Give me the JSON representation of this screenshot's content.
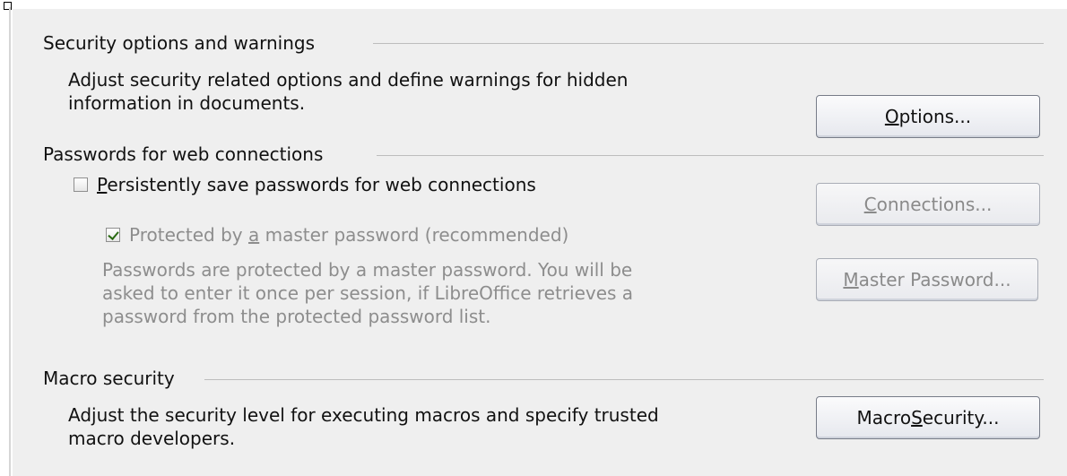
{
  "security_options": {
    "title": "Security options and warnings",
    "description_line1": "Adjust security related options and define warnings for hidden",
    "description_line2": "information in documents.",
    "options_button": {
      "mnemonic": "O",
      "rest": "ptions..."
    }
  },
  "passwords": {
    "title": "Passwords for web connections",
    "persist_checkbox": {
      "checked": false,
      "mnemonic": "P",
      "rest": "ersistently save passwords for web connections"
    },
    "connections_button": {
      "mnemonic": "C",
      "rest": "onnections...",
      "enabled": false
    },
    "master_checkbox": {
      "checked": true,
      "enabled": false,
      "prefix": "Protected by ",
      "mnemonic": "a",
      "suffix": " master password (recommended)"
    },
    "master_description_line1": "Passwords are protected by a master password. You will be",
    "master_description_line2": "asked to enter it once per session, if LibreOffice retrieves a",
    "master_description_line3": "password from the protected password list.",
    "master_password_button": {
      "mnemonic": "M",
      "rest": "aster Password...",
      "enabled": false
    }
  },
  "macro_security": {
    "title": "Macro security",
    "description_line1": "Adjust the security level for executing macros and specify trusted",
    "description_line2": "macro developers.",
    "macro_button": {
      "prefix": "Macro ",
      "mnemonic": "S",
      "rest": "ecurity..."
    }
  }
}
